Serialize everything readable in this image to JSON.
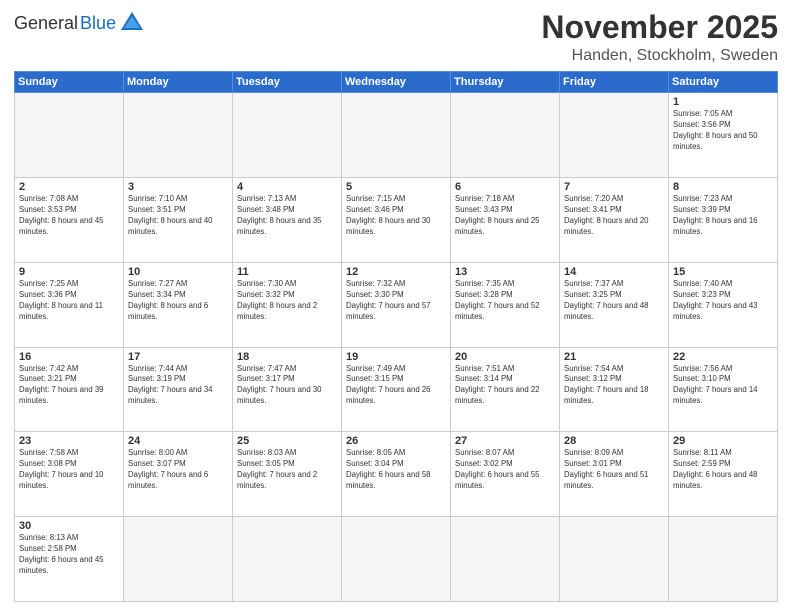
{
  "header": {
    "logo_general": "General",
    "logo_blue": "Blue",
    "month_title": "November 2025",
    "location": "Handen, Stockholm, Sweden"
  },
  "weekdays": [
    "Sunday",
    "Monday",
    "Tuesday",
    "Wednesday",
    "Thursday",
    "Friday",
    "Saturday"
  ],
  "weeks": [
    [
      {
        "day": "",
        "empty": true
      },
      {
        "day": "",
        "empty": true
      },
      {
        "day": "",
        "empty": true
      },
      {
        "day": "",
        "empty": true
      },
      {
        "day": "",
        "empty": true
      },
      {
        "day": "",
        "empty": true
      },
      {
        "day": "1",
        "sunrise": "7:05 AM",
        "sunset": "3:56 PM",
        "daylight": "8 hours and 50 minutes."
      }
    ],
    [
      {
        "day": "2",
        "sunrise": "7:08 AM",
        "sunset": "3:53 PM",
        "daylight": "8 hours and 45 minutes."
      },
      {
        "day": "3",
        "sunrise": "7:10 AM",
        "sunset": "3:51 PM",
        "daylight": "8 hours and 40 minutes."
      },
      {
        "day": "4",
        "sunrise": "7:13 AM",
        "sunset": "3:48 PM",
        "daylight": "8 hours and 35 minutes."
      },
      {
        "day": "5",
        "sunrise": "7:15 AM",
        "sunset": "3:46 PM",
        "daylight": "8 hours and 30 minutes."
      },
      {
        "day": "6",
        "sunrise": "7:18 AM",
        "sunset": "3:43 PM",
        "daylight": "8 hours and 25 minutes."
      },
      {
        "day": "7",
        "sunrise": "7:20 AM",
        "sunset": "3:41 PM",
        "daylight": "8 hours and 20 minutes."
      },
      {
        "day": "8",
        "sunrise": "7:23 AM",
        "sunset": "3:39 PM",
        "daylight": "8 hours and 16 minutes."
      }
    ],
    [
      {
        "day": "9",
        "sunrise": "7:25 AM",
        "sunset": "3:36 PM",
        "daylight": "8 hours and 11 minutes."
      },
      {
        "day": "10",
        "sunrise": "7:27 AM",
        "sunset": "3:34 PM",
        "daylight": "8 hours and 6 minutes."
      },
      {
        "day": "11",
        "sunrise": "7:30 AM",
        "sunset": "3:32 PM",
        "daylight": "8 hours and 2 minutes."
      },
      {
        "day": "12",
        "sunrise": "7:32 AM",
        "sunset": "3:30 PM",
        "daylight": "7 hours and 57 minutes."
      },
      {
        "day": "13",
        "sunrise": "7:35 AM",
        "sunset": "3:28 PM",
        "daylight": "7 hours and 52 minutes."
      },
      {
        "day": "14",
        "sunrise": "7:37 AM",
        "sunset": "3:25 PM",
        "daylight": "7 hours and 48 minutes."
      },
      {
        "day": "15",
        "sunrise": "7:40 AM",
        "sunset": "3:23 PM",
        "daylight": "7 hours and 43 minutes."
      }
    ],
    [
      {
        "day": "16",
        "sunrise": "7:42 AM",
        "sunset": "3:21 PM",
        "daylight": "7 hours and 39 minutes."
      },
      {
        "day": "17",
        "sunrise": "7:44 AM",
        "sunset": "3:19 PM",
        "daylight": "7 hours and 34 minutes."
      },
      {
        "day": "18",
        "sunrise": "7:47 AM",
        "sunset": "3:17 PM",
        "daylight": "7 hours and 30 minutes."
      },
      {
        "day": "19",
        "sunrise": "7:49 AM",
        "sunset": "3:15 PM",
        "daylight": "7 hours and 26 minutes."
      },
      {
        "day": "20",
        "sunrise": "7:51 AM",
        "sunset": "3:14 PM",
        "daylight": "7 hours and 22 minutes."
      },
      {
        "day": "21",
        "sunrise": "7:54 AM",
        "sunset": "3:12 PM",
        "daylight": "7 hours and 18 minutes."
      },
      {
        "day": "22",
        "sunrise": "7:56 AM",
        "sunset": "3:10 PM",
        "daylight": "7 hours and 14 minutes."
      }
    ],
    [
      {
        "day": "23",
        "sunrise": "7:58 AM",
        "sunset": "3:08 PM",
        "daylight": "7 hours and 10 minutes."
      },
      {
        "day": "24",
        "sunrise": "8:00 AM",
        "sunset": "3:07 PM",
        "daylight": "7 hours and 6 minutes."
      },
      {
        "day": "25",
        "sunrise": "8:03 AM",
        "sunset": "3:05 PM",
        "daylight": "7 hours and 2 minutes."
      },
      {
        "day": "26",
        "sunrise": "8:05 AM",
        "sunset": "3:04 PM",
        "daylight": "6 hours and 58 minutes."
      },
      {
        "day": "27",
        "sunrise": "8:07 AM",
        "sunset": "3:02 PM",
        "daylight": "6 hours and 55 minutes."
      },
      {
        "day": "28",
        "sunrise": "8:09 AM",
        "sunset": "3:01 PM",
        "daylight": "6 hours and 51 minutes."
      },
      {
        "day": "29",
        "sunrise": "8:11 AM",
        "sunset": "2:59 PM",
        "daylight": "6 hours and 48 minutes."
      }
    ],
    [
      {
        "day": "30",
        "sunrise": "8:13 AM",
        "sunset": "2:58 PM",
        "daylight": "6 hours and 45 minutes."
      },
      {
        "day": "",
        "empty": true
      },
      {
        "day": "",
        "empty": true
      },
      {
        "day": "",
        "empty": true
      },
      {
        "day": "",
        "empty": true
      },
      {
        "day": "",
        "empty": true
      },
      {
        "day": "",
        "empty": true
      }
    ]
  ]
}
